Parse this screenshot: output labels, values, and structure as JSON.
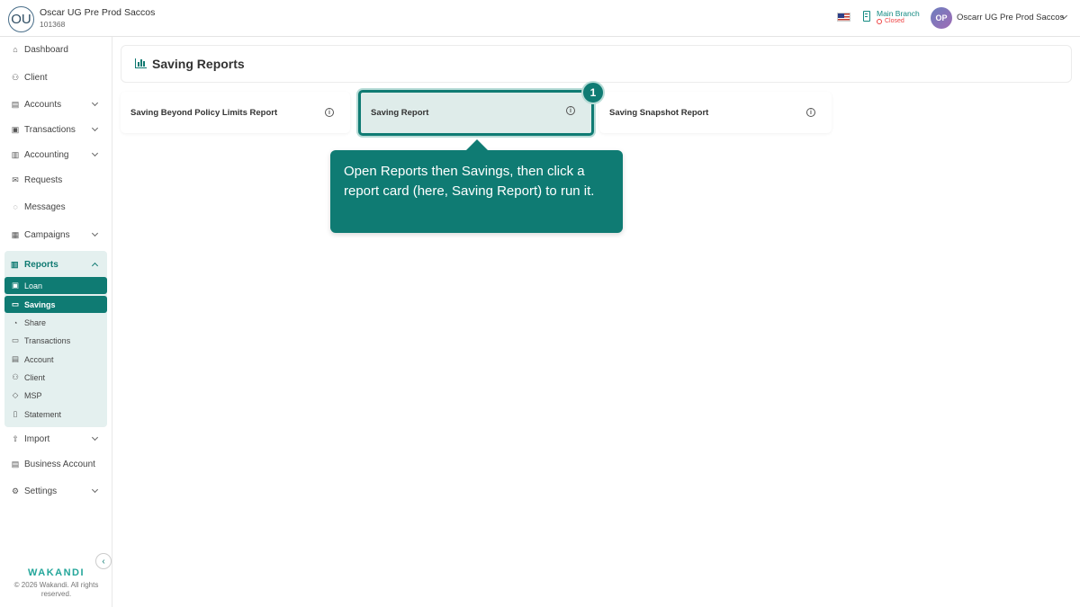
{
  "header": {
    "org_initials": "OU",
    "org_name": "Oscar UG Pre Prod Saccos",
    "org_id": "101368",
    "branch_name": "Main Branch",
    "branch_status": "Closed",
    "user_initials": "OP",
    "user_name": "Oscarr UG Pre Prod Saccos"
  },
  "sidebar": {
    "items": [
      {
        "label": "Dashboard",
        "icon": "home-icon"
      },
      {
        "label": "Client",
        "icon": "users-icon"
      },
      {
        "label": "Accounts",
        "icon": "briefcase-icon"
      },
      {
        "label": "Transactions",
        "icon": "cash-icon"
      },
      {
        "label": "Accounting",
        "icon": "ledger-icon"
      },
      {
        "label": "Requests",
        "icon": "mail-icon"
      },
      {
        "label": "Messages",
        "icon": "chat-icon"
      },
      {
        "label": "Campaigns",
        "icon": "grid-icon"
      },
      {
        "label": "Reports",
        "icon": "chart-icon"
      },
      {
        "label": "Import",
        "icon": "upload-icon"
      },
      {
        "label": "Business Account",
        "icon": "briefcase-icon"
      },
      {
        "label": "Settings",
        "icon": "gear-icon"
      }
    ],
    "report_sub_items": [
      {
        "label": "Loan",
        "icon": "cash-icon"
      },
      {
        "label": "Savings",
        "icon": "wallet-icon"
      },
      {
        "label": "Share",
        "icon": "pie-icon"
      },
      {
        "label": "Transactions",
        "icon": "card-icon"
      },
      {
        "label": "Account",
        "icon": "ledger-icon"
      },
      {
        "label": "Client",
        "icon": "users-icon"
      },
      {
        "label": "MSP",
        "icon": "shield-icon"
      },
      {
        "label": "Statement",
        "icon": "document-icon"
      }
    ],
    "brand": "WAKANDI",
    "copyright": "© 2026 Wakandi. All rights reserved."
  },
  "main": {
    "title": "Saving Reports",
    "cards": [
      {
        "label": "Saving Beyond Policy Limits Report"
      },
      {
        "label": "Saving Report"
      },
      {
        "label": "Saving Snapshot Report"
      }
    ]
  },
  "guide": {
    "step": "1",
    "text": "Open Reports then Savings, then click a report card (here, Saving Report) to run it."
  },
  "colors": {
    "accent": "#0f7b73",
    "accent_light": "#e4f0ef",
    "closed": "#e44444"
  }
}
